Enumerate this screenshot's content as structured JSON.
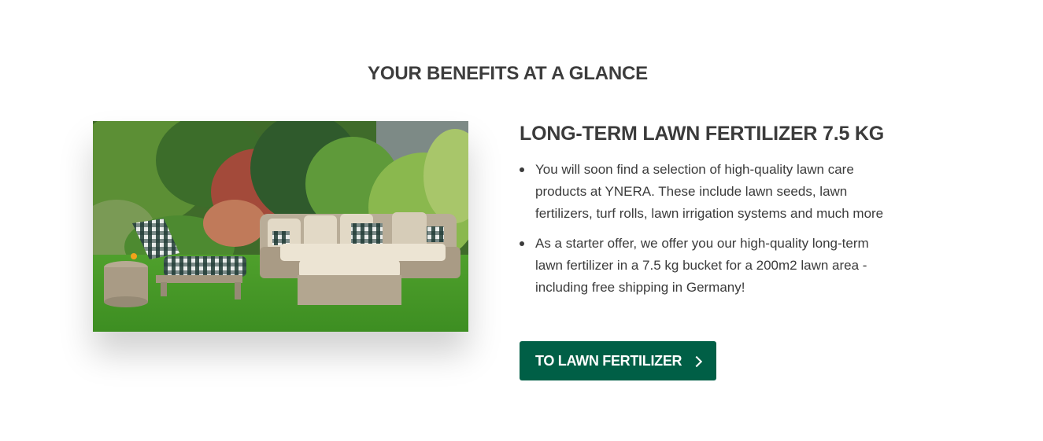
{
  "section": {
    "title": "YOUR BENEFITS AT A GLANCE"
  },
  "image": {
    "icon": "garden-lounge-furniture-photo"
  },
  "product": {
    "title": "LONG-TERM LAWN FERTILIZER 7.5 KG",
    "benefits": [
      "You will soon find a selection of high-quality lawn care products at YNERA. These include lawn seeds, lawn fertilizers, turf rolls, lawn irrigation systems and much more",
      "As a starter offer, we offer you our high-quality long-term lawn fertilizer in a 7.5 kg bucket for a 200m2 lawn area - including free shipping in Germany!"
    ]
  },
  "cta": {
    "label": "TO LAWN FERTILIZER",
    "icon": "chevron-right-icon",
    "color": "#005f46"
  }
}
